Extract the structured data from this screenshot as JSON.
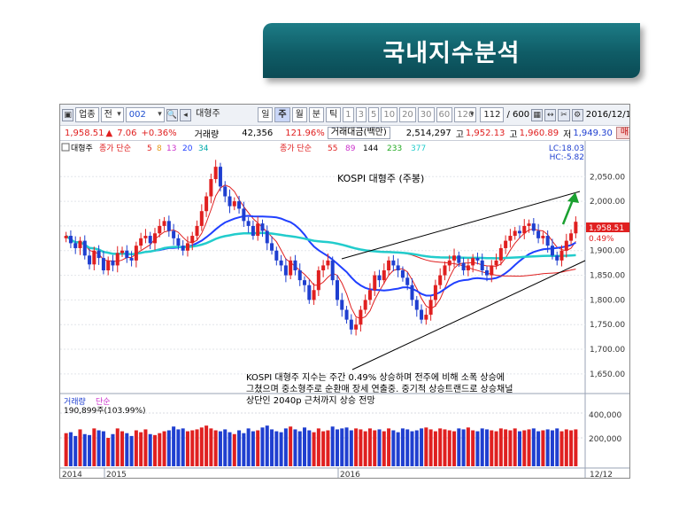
{
  "slide": {
    "title": "국내지수분석"
  },
  "toolbar": {
    "sector_label": "업종",
    "prev_label": "전",
    "code": "002",
    "name": "대형주",
    "periods": [
      "일",
      "주",
      "월",
      "분",
      "틱"
    ],
    "selected_period": "주",
    "multipliers": [
      "1",
      "3",
      "5",
      "10",
      "20",
      "30",
      "60",
      "120"
    ],
    "count": "112",
    "total": "/ 600",
    "date": "2016/12/1"
  },
  "quote": {
    "price": "1,958.51",
    "arrow": "▲",
    "change": "7.06",
    "change_pct": "+0.36%",
    "volume_label": "거래량",
    "volume": "42,356",
    "volume_ratio": "121.96%",
    "amount_label": "거래대금(백만)",
    "amount": "2,514,297",
    "high_label": "고",
    "high": "1,952.13",
    "close_label": "고",
    "close": "1,960.89",
    "low_label": "저",
    "low": "1,949.30",
    "buy_label": "매수",
    "sell_label": "매"
  },
  "legend": {
    "name": "대형주",
    "ma_label_1": "종가 단순",
    "ma_periods_1": [
      "5",
      "8",
      "13",
      "20",
      "34"
    ],
    "ma_colors_1": [
      "#e02020",
      "#e59a1a",
      "#cc33cc",
      "#2040ff",
      "#00aaaa"
    ],
    "ma_label_2": "종가 단순",
    "ma_periods_2": [
      "55",
      "89",
      "144",
      "233",
      "377"
    ],
    "ma_colors_2": [
      "#e02020",
      "#cc33cc",
      "#000000",
      "#22aa22",
      "#22cccc"
    ],
    "lc": "LC:18.03",
    "hc": "HC:-5.82"
  },
  "price_axis": [
    "2,050.00",
    "2,000.00",
    "1,950.00",
    "1,900.00",
    "1,850.00",
    "1,800.00",
    "1,750.00",
    "1,700.00",
    "1,650.00"
  ],
  "price_tag": {
    "value": "1,958.51",
    "pct": "0.49%"
  },
  "chart_label": "KOSPI 대형주 (주봉)",
  "comment": [
    "KOSPI 대형주 지수는 주간 0.49% 상승하며 전주에 비해 소폭 상승에",
    "그쳤으며 중소형주로 순환매 장세 연출중. 중기적 상승트랜드로 상승채널",
    "상단인 2040p 근처까지 상승 전망"
  ],
  "volume_panel": {
    "title_a": "거래량",
    "title_b": "단순",
    "value": "190,899주(103.99%)",
    "axis": [
      "400,000",
      "200,000"
    ]
  },
  "x_axis": {
    "labels": [
      "2014",
      "2015",
      "2016"
    ],
    "right": "12/12"
  },
  "colors": {
    "banner": "#0f5c66",
    "up": "#e02020",
    "down": "#1f3fd0",
    "channel": "#000000",
    "target_arrow": "#1aa030"
  },
  "chart_data": {
    "type": "candlestick",
    "title": "KOSPI 대형주 (주봉)",
    "ylim": [
      1630,
      2090
    ],
    "ma_series": [
      {
        "name": "5",
        "color": "#e02020"
      },
      {
        "name": "20",
        "color": "#2040ff"
      },
      {
        "name": "55",
        "color": "#e02020"
      },
      {
        "name": "144",
        "color": "#000000"
      },
      {
        "name": "377",
        "color": "#22cccc"
      }
    ],
    "candles_close": [
      1930,
      1915,
      1905,
      1920,
      1890,
      1872,
      1900,
      1885,
      1860,
      1880,
      1870,
      1895,
      1900,
      1885,
      1880,
      1910,
      1925,
      1930,
      1915,
      1935,
      1950,
      1960,
      1940,
      1925,
      1910,
      1900,
      1915,
      1930,
      1950,
      1980,
      2010,
      2045,
      2070,
      2030,
      2010,
      1990,
      2000,
      1985,
      1960,
      1950,
      1930,
      1955,
      1940,
      1915,
      1900,
      1880,
      1870,
      1850,
      1880,
      1860,
      1840,
      1830,
      1800,
      1820,
      1860,
      1870,
      1880,
      1840,
      1800,
      1780,
      1760,
      1740,
      1750,
      1780,
      1800,
      1820,
      1850,
      1840,
      1860,
      1880,
      1870,
      1860,
      1845,
      1830,
      1800,
      1780,
      1760,
      1770,
      1800,
      1830,
      1850,
      1870,
      1880,
      1890,
      1875,
      1860,
      1870,
      1885,
      1880,
      1860,
      1850,
      1870,
      1880,
      1905,
      1920,
      1930,
      1940,
      1935,
      1950,
      1955,
      1940,
      1925,
      1930,
      1910,
      1890,
      1880,
      1900,
      1920,
      1935,
      1958.51
    ],
    "volume": [
      175,
      180,
      160,
      195,
      170,
      165,
      200,
      190,
      185,
      150,
      170,
      200,
      185,
      175,
      160,
      190,
      180,
      195,
      170,
      165,
      175,
      185,
      190,
      210,
      195,
      200,
      185,
      190,
      195,
      205,
      215,
      200,
      190,
      185,
      195,
      180,
      170,
      190,
      175,
      200,
      185,
      190,
      205,
      215,
      195,
      185,
      180,
      200,
      210,
      195,
      185,
      205,
      190,
      180,
      200,
      185,
      190,
      210,
      195,
      200,
      205,
      190,
      200,
      195,
      185,
      200,
      190,
      195,
      185,
      200,
      190,
      180,
      200,
      195,
      185,
      190,
      200,
      205,
      195,
      185,
      200,
      195,
      190,
      185,
      200,
      195,
      205,
      190,
      185,
      200,
      195,
      190,
      185,
      200,
      195,
      190,
      200,
      185,
      190,
      195,
      200,
      185,
      190,
      195,
      190,
      200,
      185,
      195,
      190,
      195
    ]
  }
}
